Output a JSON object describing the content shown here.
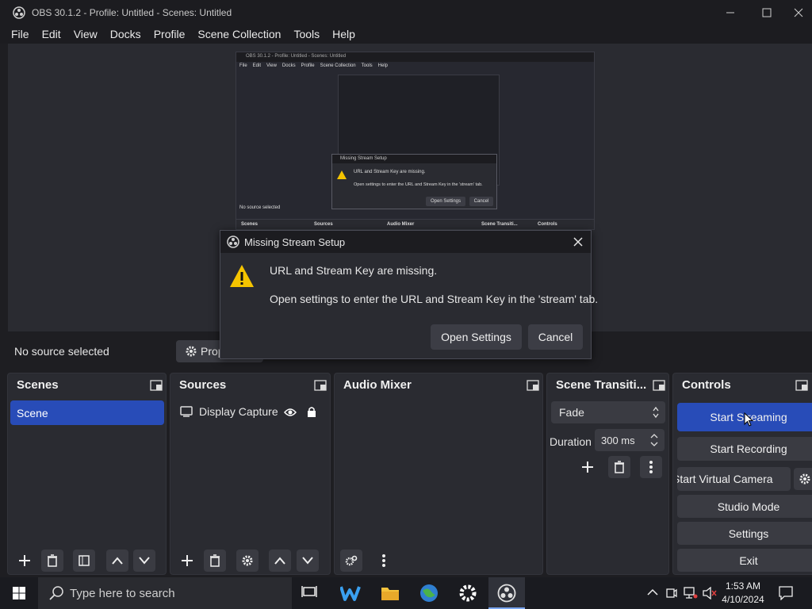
{
  "window": {
    "title": "OBS 30.1.2 - Profile: Untitled - Scenes: Untitled"
  },
  "menu": [
    "File",
    "Edit",
    "View",
    "Docks",
    "Profile",
    "Scene Collection",
    "Tools",
    "Help"
  ],
  "preview_nested": {
    "title": "OBS 30.1.2 - Profile: Untitled - Scenes: Untitled",
    "menu": [
      "File",
      "Edit",
      "View",
      "Docks",
      "Profile",
      "Scene Collection",
      "Tools",
      "Help"
    ],
    "status": "No source selected",
    "dialog_title": "Missing Stream Setup",
    "dialog_msg1": "URL and Stream Key are missing.",
    "dialog_msg2": "Open settings to enter the URL and Stream Key in the 'stream' tab.",
    "btn_open": "Open Settings",
    "btn_cancel": "Cancel",
    "docks": [
      "Scenes",
      "Sources",
      "Audio Mixer",
      "Scene Transiti...",
      "Controls"
    ]
  },
  "source_bar": {
    "no_source": "No source selected",
    "properties_label": "Prop"
  },
  "scenes": {
    "title": "Scenes",
    "items": [
      "Scene"
    ]
  },
  "sources": {
    "title": "Sources",
    "items": [
      {
        "name": "Display Capture"
      }
    ]
  },
  "audio_mixer": {
    "title": "Audio Mixer"
  },
  "transitions": {
    "title": "Scene Transiti...",
    "selected": "Fade",
    "duration_label": "Duration",
    "duration_value": "300 ms"
  },
  "controls": {
    "title": "Controls",
    "start_streaming": "Start Streaming",
    "start_recording": "Start Recording",
    "start_virtual_camera": "Start Virtual Camera",
    "studio_mode": "Studio Mode",
    "settings": "Settings",
    "exit": "Exit"
  },
  "dialog": {
    "title": "Missing Stream Setup",
    "message": "URL and Stream Key are missing.",
    "detail": "Open settings to enter the URL and Stream Key in the 'stream' tab.",
    "open_settings": "Open Settings",
    "cancel": "Cancel"
  },
  "taskbar": {
    "search_placeholder": "Type here to search",
    "time": "1:53 AM",
    "date": "4/10/2024"
  },
  "colors": {
    "accent": "#284cb8",
    "warning": "#f5c400"
  }
}
